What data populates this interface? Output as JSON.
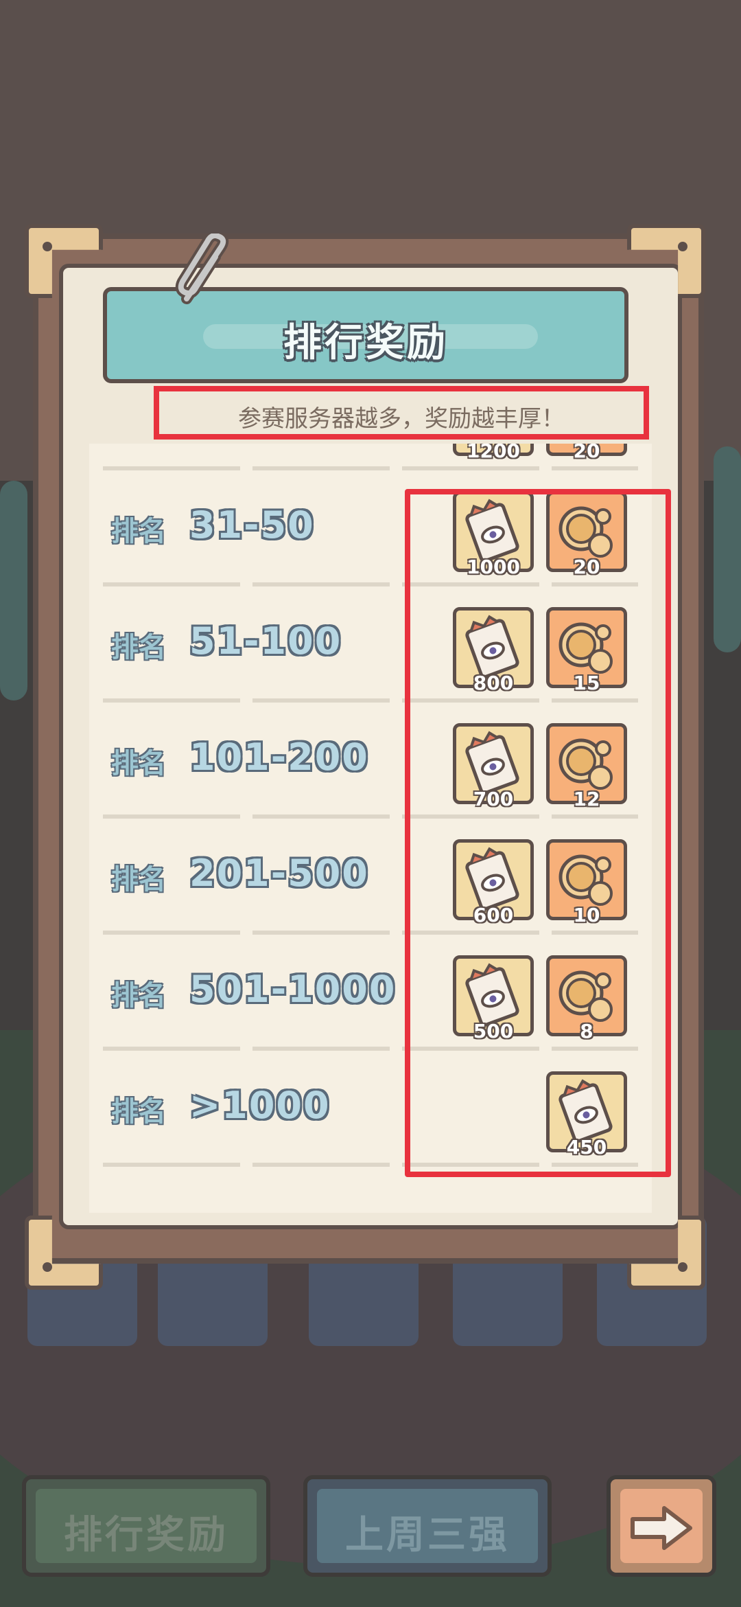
{
  "panel": {
    "title": "排行奖励",
    "subtitle": "参赛服务器越多，奖励越丰厚！"
  },
  "rank_prefix": "排名",
  "partial_row": {
    "ticket_count": "1200",
    "coin_count": "20"
  },
  "rows": [
    {
      "range": "31-50",
      "ticket_count": "1000",
      "coin_count": "20"
    },
    {
      "range": "51-100",
      "ticket_count": "800",
      "coin_count": "15"
    },
    {
      "range": "101-200",
      "ticket_count": "700",
      "coin_count": "12"
    },
    {
      "range": "201-500",
      "ticket_count": "600",
      "coin_count": "10"
    },
    {
      "range": "501-1000",
      "ticket_count": "500",
      "coin_count": "8"
    },
    {
      "range": ">1000",
      "ticket_count": "450"
    }
  ],
  "bottom_bar": {
    "rank_rewards_label": "排行奖励",
    "last_week_top3_label": "上周三强"
  },
  "icons": {
    "ticket": "ticket-icon",
    "coin": "coin-icon",
    "clip": "paperclip-icon",
    "next": "arrow-right-icon"
  },
  "colors": {
    "highlight": "#e8323e",
    "banner": "#86c7c6",
    "board": "#efe8d9"
  }
}
